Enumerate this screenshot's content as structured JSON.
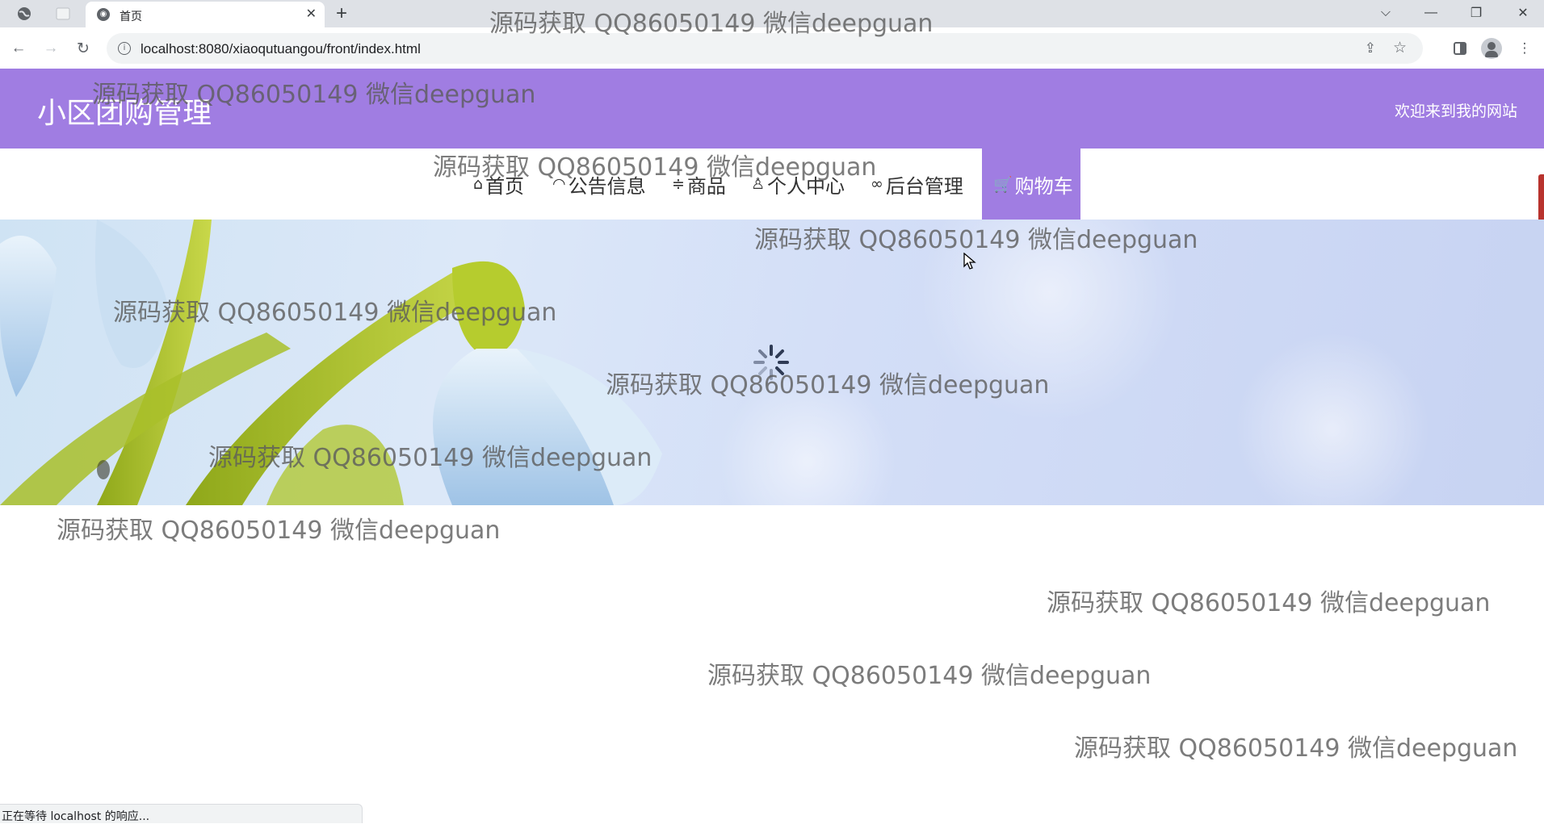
{
  "browser": {
    "tab_title": "首页",
    "url": "localhost:8080/xiaoqutuangou/front/index.html",
    "status_text": "正在等待 localhost 的响应..."
  },
  "site": {
    "title": "小区团购管理",
    "welcome": "欢迎来到我的网站"
  },
  "nav": {
    "items": [
      {
        "label": "首页",
        "icon": "home-icon"
      },
      {
        "label": "公告信息",
        "icon": "gauge-icon"
      },
      {
        "label": "商品",
        "icon": "sliders-icon"
      },
      {
        "label": "个人中心",
        "icon": "user-icon"
      },
      {
        "label": "后台管理",
        "icon": "link-icon"
      },
      {
        "label": "购物车",
        "icon": "cart-icon",
        "active": true
      }
    ]
  },
  "watermark": {
    "text": "源码获取 QQ86050149 微信deepguan"
  },
  "colors": {
    "brand": "#a07de2",
    "chrome_bg": "#dee1e6"
  }
}
